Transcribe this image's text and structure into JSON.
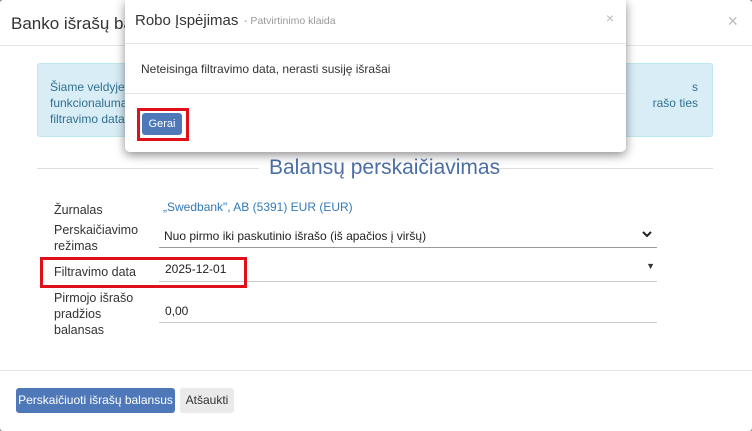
{
  "main_modal": {
    "title": "Banko išrašų bala",
    "close_glyph": "×",
    "info_left": "Šiame veldyje g\nfunkcionalumas\nfiltravimo data.",
    "info_right": "s\nrašo ties",
    "section_title": "Balansų perskaičiavimas",
    "fields": {
      "journal_label": "Žurnalas",
      "journal_value": "„Swedbank\", AB (5391) EUR (EUR)",
      "mode_label_1": "Perskaičiavimo",
      "mode_label_2": "režimas",
      "mode_value": "Nuo pirmo iki paskutinio išrašo (iš apačios į viršų)",
      "date_label": "Filtravimo data",
      "date_value": "2025-12-01",
      "balance_label_1": "Pirmojo išrašo",
      "balance_label_2": "pradžios",
      "balance_label_3": "balansas",
      "balance_value": "0,00"
    },
    "buttons": {
      "recalculate": "Perskaičiuoti išrašų balansus",
      "cancel": "Atšaukti"
    }
  },
  "dialog": {
    "title": "Robo Įspėjimas",
    "subtitle": "- Patvirtinimo klaida",
    "close_glyph": "×",
    "message": "Neteisinga filtravimo data, nerasti susiję išrašai",
    "ok_label": "Gerai"
  },
  "colors": {
    "primary": "#4f78b8",
    "highlight": "#e0101a",
    "info_bg": "#d9edf7",
    "section_title": "#4a6fa5"
  },
  "icons": {
    "select_chevron": "chevron-down-icon",
    "date_caret": "caret-down-icon",
    "close": "close-icon"
  }
}
